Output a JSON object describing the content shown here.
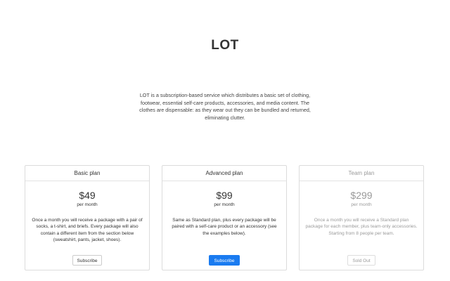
{
  "hero": {
    "title": "LOT",
    "description": "LOT is a subscription-based service which distributes a basic set of clothing, footwear, essential self-care products, accessories, and media content. The clothes are dispensable: as they wear out they can be bundled and returned, eliminating clutter."
  },
  "plans": [
    {
      "name": "Basic plan",
      "price": "$49",
      "period": "per month",
      "description": "Once a month you will receive a package with a pair of socks, a t-shirt, and briefs. Every package will also contain a different item from the section below (sweatshirt, pants, jacket, shoes).",
      "button_label": "Subscribe",
      "button_style": "outline",
      "disabled": false
    },
    {
      "name": "Advanced plan",
      "price": "$99",
      "period": "per month",
      "description": "Same as Standard plan, plus every package will be paired with a self-care product or an accessory (see the examples below).",
      "button_label": "Subscribe",
      "button_style": "primary",
      "disabled": false
    },
    {
      "name": "Team plan",
      "price": "$299",
      "period": "per month",
      "description": "Once a month you will receive a Standard plan package for each member, plus team-only accessories. Starting from 8 people per team.",
      "button_label": "Sold Out",
      "button_style": "outline",
      "disabled": true
    }
  ],
  "colors": {
    "primary": "#1a7bf0",
    "text": "#333333",
    "muted": "#9a9a9a",
    "border": "#dcdcdc"
  }
}
